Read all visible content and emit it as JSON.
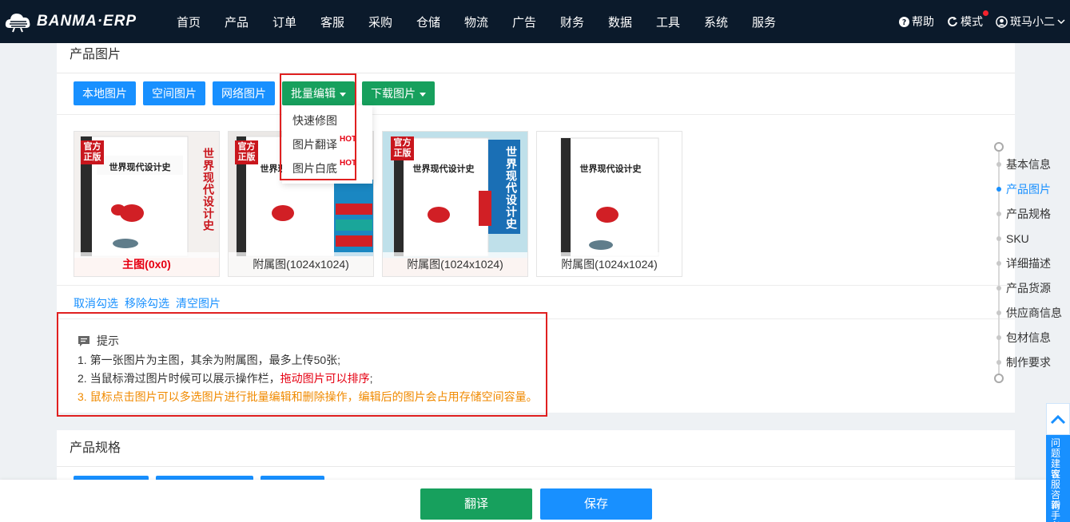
{
  "colors": {
    "nav_bg": "#0b1a2b",
    "primary": "#1890ff",
    "success": "#17a05d",
    "danger": "#e60012",
    "warning": "#f08a00"
  },
  "logo": {
    "text": "BANMA·ERP",
    "icon": "zebra-cloud-logo"
  },
  "nav": [
    "首页",
    "产品",
    "订单",
    "客服",
    "采购",
    "仓储",
    "物流",
    "广告",
    "财务",
    "数据",
    "工具",
    "系统",
    "服务"
  ],
  "topright": {
    "help": "帮助",
    "mode": "模式",
    "user": "斑马小二"
  },
  "images_section": {
    "title": "产品图片",
    "buttons": {
      "local": "本地图片",
      "space": "空间图片",
      "network": "网络图片",
      "batch_edit": "批量编辑",
      "download": "下载图片"
    },
    "dropdown": [
      {
        "label": "快速修图",
        "hot": ""
      },
      {
        "label": "图片翻译",
        "hot": "HOT"
      },
      {
        "label": "图片白底",
        "hot": "HOT"
      }
    ],
    "images": [
      {
        "caption": "主图(0x0)",
        "seal": "官方正版",
        "vtitle": "世界现代设计史"
      },
      {
        "caption": "附属图(1024x1024)",
        "seal": "官方正版",
        "vtitle": ""
      },
      {
        "caption": "附属图(1024x1024)",
        "seal": "官方正版",
        "vtitle": "世界现代设计史"
      },
      {
        "caption": "附属图(1024x1024)",
        "seal": "",
        "vtitle": ""
      }
    ],
    "links": {
      "cancel": "取消勾选",
      "remove": "移除勾选",
      "clear": "清空图片"
    },
    "tips": {
      "head": "提示",
      "line1": "1. 第一张图片为主图，其余为附属图，最多上传50张;",
      "line2a": "2. 当鼠标滑过图片时候可以展示操作栏，",
      "line2b": "拖动图片可以排序",
      "line2c": ";",
      "line3": "3. 鼠标点击图片可以多选图片进行批量编辑和删除操作，编辑后的图片会占用存储空间容量。"
    }
  },
  "spec_section": {
    "title": "产品规格"
  },
  "anchor_nav": [
    "基本信息",
    "产品图片",
    "产品规格",
    "SKU",
    "详细描述",
    "产品货源",
    "供应商信息",
    "包材信息",
    "制作要求"
  ],
  "anchor_active": 1,
  "helper": [
    "问题建议",
    "客服咨询",
    "新手必看"
  ],
  "bottom": {
    "translate": "翻译",
    "save": "保存"
  }
}
